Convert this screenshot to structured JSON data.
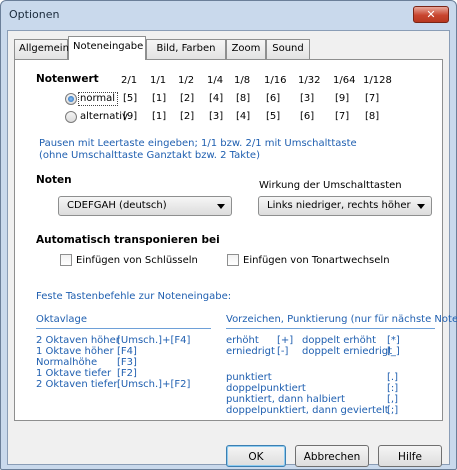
{
  "window": {
    "title": "Optionen",
    "close_glyph": "✕"
  },
  "tabs": [
    {
      "label": "Allgemein"
    },
    {
      "label": "Noteneingabe"
    },
    {
      "label": "Bild, Farben"
    },
    {
      "label": "Zoom"
    },
    {
      "label": "Sound"
    }
  ],
  "notenwert": {
    "heading": "Notenwert",
    "columns": [
      "2/1",
      "1/1",
      "1/2",
      "1/4",
      "1/8",
      "1/16",
      "1/32",
      "1/64",
      "1/128"
    ],
    "rows": [
      {
        "label": "normal",
        "checked": true,
        "keys": [
          "[5]",
          "[1]",
          "[2]",
          "[4]",
          "[8]",
          "[6]",
          "[3]",
          "[9]",
          "[7]"
        ]
      },
      {
        "label": "alternativ",
        "checked": false,
        "keys": [
          "[9]",
          "[1]",
          "[2]",
          "[3]",
          "[4]",
          "[5]",
          "[6]",
          "[7]",
          "[8]"
        ]
      }
    ],
    "note_line1": "Pausen mit Leertaste eingeben; 1/1 bzw. 2/1 mit Umschalttaste",
    "note_line2": "(ohne Umschalttaste Ganztakt bzw. 2 Takte)"
  },
  "noten": {
    "heading": "Noten",
    "select_value": "CDEFGAH (deutsch)",
    "shift_label": "Wirkung der Umschalttasten",
    "shift_value": "Links niedriger, rechts höher"
  },
  "transpose": {
    "heading": "Automatisch transponieren bei",
    "clef_label": "Einfügen von Schlüsseln",
    "key_label": "Einfügen von Tonartwechseln"
  },
  "shortcuts": {
    "heading": "Feste Tastenbefehle zur Noteneingabe:",
    "oktavlage": {
      "heading": "Oktavlage",
      "items": [
        {
          "label": "2 Oktaven höher",
          "key": "[Umsch.]+[F4]"
        },
        {
          "label": "1 Oktave höher",
          "key": "[F4]"
        },
        {
          "label": "Normalhöhe",
          "key": "[F3]"
        },
        {
          "label": "1 Oktave tiefer",
          "key": "[F2]"
        },
        {
          "label": "2 Oktaven tiefer",
          "key": "[Umsch.]+[F2]"
        }
      ]
    },
    "vorzeichen": {
      "heading": "Vorzeichen, Punktierung (nur für nächste Note)",
      "accidentals": [
        {
          "label": "erhöht",
          "key": "[+]",
          "label2": "doppelt erhöht",
          "key2": "[*]"
        },
        {
          "label": "erniedrigt",
          "key": "[-]",
          "label2": "doppelt erniedrigt",
          "key2": "[_]"
        }
      ],
      "dots": [
        {
          "label": "punktiert",
          "key": "[.]"
        },
        {
          "label": "doppelpunktiert",
          "key": "[:]"
        },
        {
          "label": "punktiert, dann halbiert",
          "key": "[,]"
        },
        {
          "label": "doppelpunktiert, dann geviertelt",
          "key": "[;]"
        }
      ]
    }
  },
  "buttons": {
    "ok": "OK",
    "cancel": "Abbrechen",
    "help": "Hilfe"
  },
  "colors": {
    "accent_text": "#1f5fb0",
    "close_button": "#c8452e"
  }
}
